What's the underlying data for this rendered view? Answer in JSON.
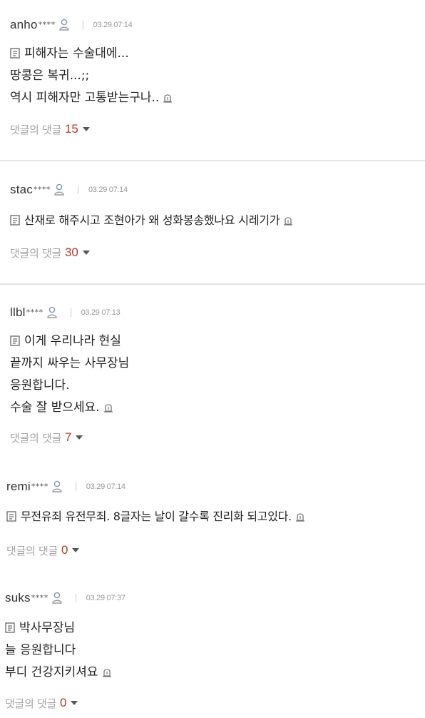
{
  "comments": [
    {
      "user": "anho",
      "masked": "****",
      "time": "03.29 07:14",
      "line1": "피해자는 수술대에...",
      "line2": "땅콩은 복귀...;;",
      "line3": "역시 피해자만 고통받는구나..",
      "reply_label": "댓글의 댓글",
      "reply_count": "15"
    },
    {
      "user": "stac",
      "masked": "****",
      "time": "03.29 07:14",
      "line1": "산재로 해주시고 조현아가 왜 성화봉송했나요 시레기가",
      "reply_label": "댓글의 댓글",
      "reply_count": "30"
    },
    {
      "user": "llbl",
      "masked": "****",
      "time": "03.29 07:13",
      "line1": "이게 우리나라 현실",
      "line2": "끝까지 싸우는 사무장님",
      "line3": "응원합니다.",
      "line4": "수술 잘 받으세요.",
      "reply_label": "댓글의 댓글",
      "reply_count": "7"
    },
    {
      "user": "remi",
      "masked": "****",
      "time": "03.29 07:14",
      "line1": "무전유죄 유전무죄. 8글자는 날이 갈수록 진리화 되고있다.",
      "reply_label": "댓글의 댓글",
      "reply_count": "0"
    },
    {
      "user": "suks",
      "masked": "****",
      "time": "03.29 07:37",
      "line1": "박사무장님",
      "line2": "늘 응원합니다",
      "line3": "부디 건강지키셔요",
      "reply_label": "댓글의 댓글",
      "reply_count": "0"
    }
  ],
  "colors": {
    "reply_count": "#b33a28",
    "reply_label": "#a5a5a5",
    "divider": "#e3e3e3"
  },
  "icons": {
    "user": "user-icon",
    "memo": "memo-icon",
    "report": "report-icon",
    "caret": "caret-down-icon"
  }
}
